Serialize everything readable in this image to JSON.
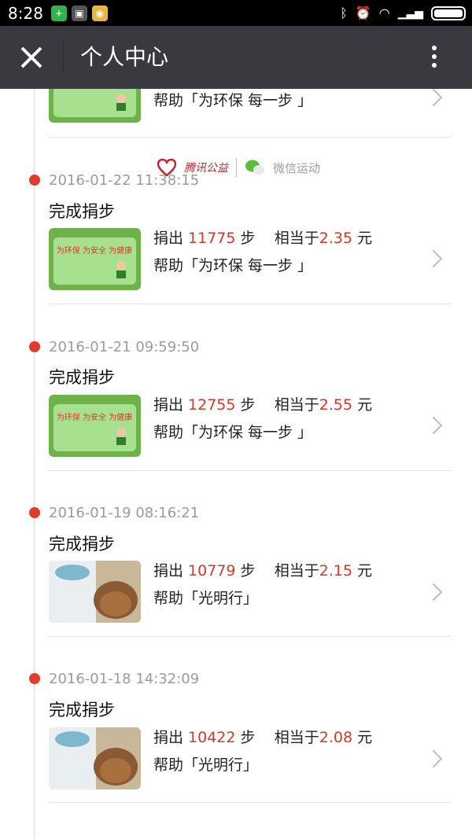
{
  "status_bar": {
    "time": "8:28"
  },
  "header": {
    "title": "个人中心"
  },
  "partner": {
    "tencent": "腾讯公益",
    "wechat": "微信运动"
  },
  "top_partial": {
    "help_text": "帮助「为环保 每一步 」"
  },
  "entries": [
    {
      "date": "2016-01-22 11:38:15",
      "title": "完成捐步",
      "donate_prefix": "捐出 ",
      "steps": "11775",
      "steps_suffix": " 步",
      "equal_text": "相当于",
      "amount": "2.35",
      "currency": " 元",
      "help": "帮助「为环保 每一步 」",
      "thumb": "eco"
    },
    {
      "date": "2016-01-21 09:59:50",
      "title": "完成捐步",
      "donate_prefix": "捐出 ",
      "steps": "12755",
      "steps_suffix": " 步",
      "equal_text": "相当于",
      "amount": "2.55",
      "currency": " 元",
      "help": "帮助「为环保 每一步 」",
      "thumb": "eco"
    },
    {
      "date": "2016-01-19 08:16:21",
      "title": "完成捐步",
      "donate_prefix": "捐出 ",
      "steps": "10779",
      "steps_suffix": " 步",
      "equal_text": "相当于",
      "amount": "2.15",
      "currency": " 元",
      "help": "帮助「光明行」",
      "thumb": "eye"
    },
    {
      "date": "2016-01-18 14:32:09",
      "title": "完成捐步",
      "donate_prefix": "捐出 ",
      "steps": "10422",
      "steps_suffix": " 步",
      "equal_text": "相当于",
      "amount": "2.08",
      "currency": " 元",
      "help": "帮助「光明行」",
      "thumb": "eye"
    }
  ],
  "colors": {
    "accent_red": "#d23927",
    "titlebar": "#393a3f"
  }
}
